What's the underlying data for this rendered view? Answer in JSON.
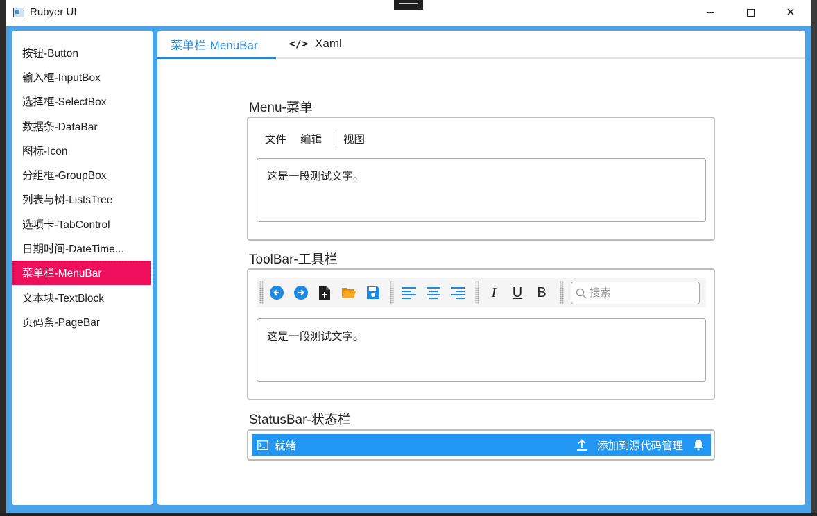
{
  "window": {
    "title": "Rubyer UI",
    "close_glyph": "✕"
  },
  "sidebar": {
    "items": [
      {
        "label": "按钮-Button"
      },
      {
        "label": "输入框-InputBox"
      },
      {
        "label": "选择框-SelectBox"
      },
      {
        "label": "数据条-DataBar"
      },
      {
        "label": "图标-Icon"
      },
      {
        "label": "分组框-GroupBox"
      },
      {
        "label": "列表与树-ListsTree"
      },
      {
        "label": "选项卡-TabControl"
      },
      {
        "label": "日期时间-DateTime..."
      },
      {
        "label": "菜单栏-MenuBar"
      },
      {
        "label": "文本块-TextBlock"
      },
      {
        "label": "页码条-PageBar"
      }
    ],
    "active_index": 9,
    "active_color": "#ee0f5c"
  },
  "tabs": [
    {
      "label": "菜单栏-MenuBar"
    },
    {
      "label": "Xaml",
      "icon": "code-icon"
    }
  ],
  "accent_color": "#2f88d6",
  "menu_section": {
    "title": "Menu-菜单",
    "menu_items": [
      "文件",
      "编辑",
      "视图"
    ],
    "text": "这是一段测试文字。"
  },
  "toolbar_section": {
    "title": "ToolBar-工具栏",
    "buttons": [
      "back-icon",
      "forward-icon",
      "new-file-icon",
      "open-folder-icon",
      "save-icon",
      "align-left-icon",
      "align-center-icon",
      "align-right-icon",
      "italic-icon",
      "underline-icon",
      "bold-icon"
    ],
    "italic_label": "I",
    "underline_label": "U",
    "bold_label": "B",
    "search_placeholder": "搜索",
    "text": "这是一段测试文字。"
  },
  "status_section": {
    "title": "StatusBar-状态栏",
    "status_text": "就绪",
    "source_control_label": "添加到源代码管理",
    "bar_color": "#2196f3"
  }
}
